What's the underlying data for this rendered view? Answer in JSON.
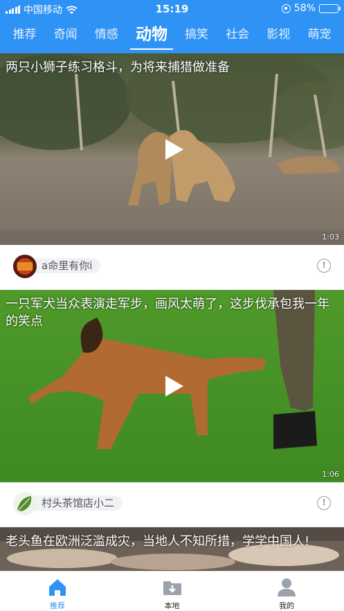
{
  "status_bar": {
    "carrier": "中国移动",
    "time": "15:19",
    "battery_percent": "58%",
    "battery_level": 0.58
  },
  "tabs": [
    {
      "label": "推荐",
      "active": false
    },
    {
      "label": "奇闻",
      "active": false
    },
    {
      "label": "情感",
      "active": false
    },
    {
      "label": "动物",
      "active": true
    },
    {
      "label": "搞笑",
      "active": false
    },
    {
      "label": "社会",
      "active": false
    },
    {
      "label": "影视",
      "active": false
    },
    {
      "label": "萌宠",
      "active": false
    }
  ],
  "feed": [
    {
      "title": "两只小狮子练习格斗，为将来捕猎做准备",
      "duration": "1:03",
      "author": "a命里有你i",
      "more_icon": "!"
    },
    {
      "title": "一只军犬当众表演走军步，画风太萌了，这步伐承包我一年的笑点",
      "duration": "1:06",
      "author": "村头茶馆店小二",
      "more_icon": "!"
    },
    {
      "title": "老头鱼在欧洲泛滥成灾，当地人不知所措，学学中国人!",
      "duration": "",
      "author": ""
    }
  ],
  "bottom_nav": [
    {
      "label": "推荐",
      "icon": "home-icon",
      "active": true
    },
    {
      "label": "本地",
      "icon": "folder-download-icon",
      "active": false
    },
    {
      "label": "我的",
      "icon": "person-icon",
      "active": false
    }
  ],
  "colors": {
    "accent": "#2e93f5",
    "header_bg": "#2e93f5",
    "inactive_icon": "#9aa3ad"
  }
}
